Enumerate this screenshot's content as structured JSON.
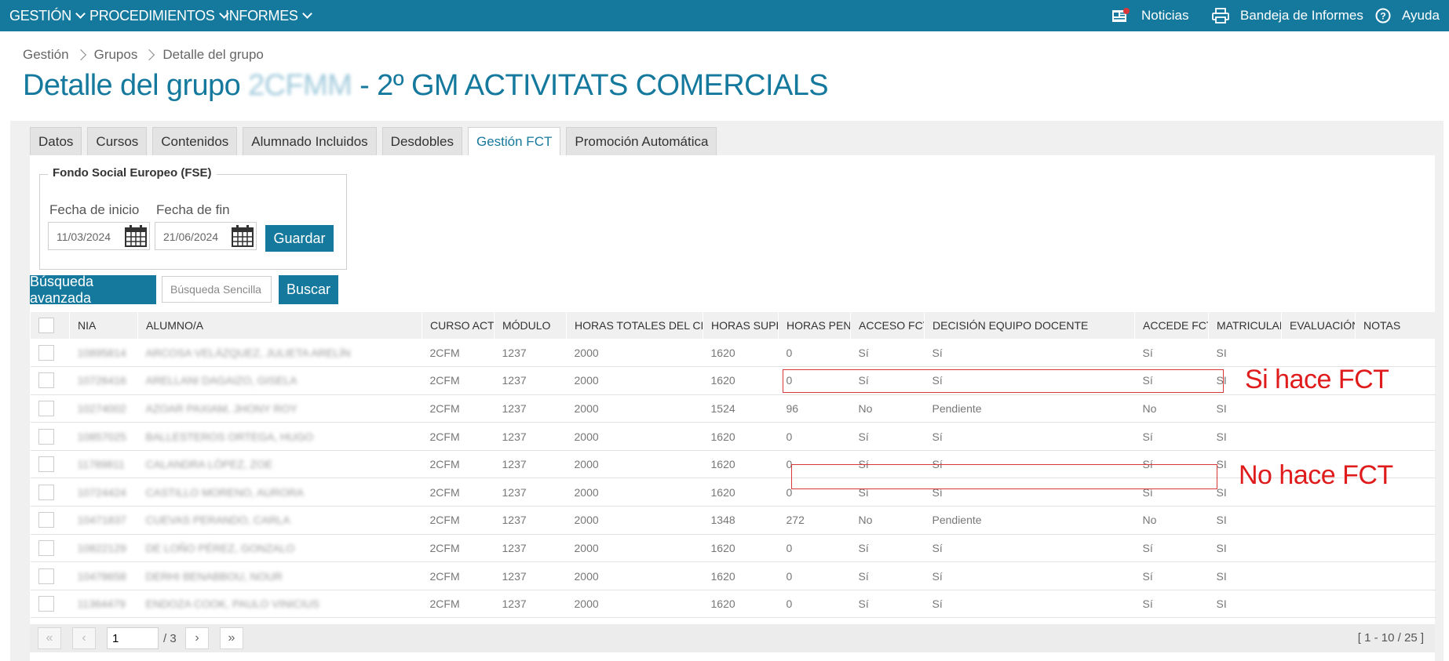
{
  "topbar": {
    "menu": [
      "GESTIÓN",
      "PROCEDIMIENTOS",
      "INFORMES"
    ],
    "noticias": "Noticias",
    "bandeja": "Bandeja de Informes",
    "ayuda": "Ayuda",
    "colors": {
      "bar": "#15799d"
    }
  },
  "breadcrumb": [
    "Gestión",
    "Grupos",
    "Detalle del grupo"
  ],
  "title": {
    "prefix": "Detalle del grupo",
    "code": "2CFMM",
    "suffix": "- 2º GM ACTIVITATS COMERCIALS"
  },
  "tabs": [
    "Datos",
    "Cursos",
    "Contenidos",
    "Alumnado Incluidos",
    "Desdobles",
    "Gestión FCT",
    "Promoción Automática"
  ],
  "active_tab": "Gestión FCT",
  "fse": {
    "legend": "Fondo Social Europeo (FSE)",
    "start_label": "Fecha de inicio",
    "start_value": "11/03/2024",
    "end_label": "Fecha de fin",
    "end_value": "21/06/2024",
    "save": "Guardar"
  },
  "search": {
    "advanced": "Búsqueda avanzada",
    "placeholder": "Búsqueda Sencilla",
    "button": "Buscar"
  },
  "table": {
    "headers": [
      "NIA",
      "ALUMNO/A",
      "CURSO ACTUAL",
      "MÓDULO",
      "HORAS TOTALES DEL CICLO",
      "HORAS SUPERADAS",
      "HORAS PENDIENTES",
      "ACCESO FCT",
      "DECISIÓN EQUIPO DOCENTE",
      "ACCEDE FCT",
      "MATRICULADO",
      "EVALUACIÓN",
      "NOTAS"
    ],
    "rows": [
      {
        "nia": "10895814",
        "alumno": "ARCOSA VELÁZQUEZ, JULIETA ARELÍN",
        "curso": "2CFM",
        "modulo": "1237",
        "totales": "2000",
        "superadas": "1620",
        "pendientes": "0",
        "acceso": "Sí",
        "decision": "Sí",
        "accede": "Sí",
        "matriculado": "SI",
        "evaluacion": "",
        "notas": ""
      },
      {
        "nia": "10726416",
        "alumno": "ARELLANI DAGAIZO, GISELA",
        "curso": "2CFM",
        "modulo": "1237",
        "totales": "2000",
        "superadas": "1620",
        "pendientes": "0",
        "acceso": "Sí",
        "decision": "Sí",
        "accede": "Sí",
        "matriculado": "SI",
        "evaluacion": "",
        "notas": ""
      },
      {
        "nia": "10274002",
        "alumno": "AZOAR PAXIAM, JHONY ROY",
        "curso": "2CFM",
        "modulo": "1237",
        "totales": "2000",
        "superadas": "1524",
        "pendientes": "96",
        "acceso": "No",
        "decision": "Pendiente",
        "accede": "No",
        "matriculado": "SI",
        "evaluacion": "",
        "notas": ""
      },
      {
        "nia": "10857025",
        "alumno": "BALLESTEROS ORTEGA, HUGO",
        "curso": "2CFM",
        "modulo": "1237",
        "totales": "2000",
        "superadas": "1620",
        "pendientes": "0",
        "acceso": "Sí",
        "decision": "Sí",
        "accede": "Sí",
        "matriculado": "SI",
        "evaluacion": "",
        "notas": ""
      },
      {
        "nia": "11789811",
        "alumno": "CALANDRA LÓPEZ, ZOE",
        "curso": "2CFM",
        "modulo": "1237",
        "totales": "2000",
        "superadas": "1620",
        "pendientes": "0",
        "acceso": "Sí",
        "decision": "Sí",
        "accede": "Sí",
        "matriculado": "SI",
        "evaluacion": "",
        "notas": ""
      },
      {
        "nia": "10724424",
        "alumno": "CASTILLO MORENO, AURORA",
        "curso": "2CFM",
        "modulo": "1237",
        "totales": "2000",
        "superadas": "1620",
        "pendientes": "0",
        "acceso": "Sí",
        "decision": "Sí",
        "accede": "Sí",
        "matriculado": "SI",
        "evaluacion": "",
        "notas": ""
      },
      {
        "nia": "10471837",
        "alumno": "CUEVAS PERANDO, CARLA",
        "curso": "2CFM",
        "modulo": "1237",
        "totales": "2000",
        "superadas": "1348",
        "pendientes": "272",
        "acceso": "No",
        "decision": "Pendiente",
        "accede": "No",
        "matriculado": "SI",
        "evaluacion": "",
        "notas": ""
      },
      {
        "nia": "10822129",
        "alumno": "DE LOÑO PÉREZ, GONZALO",
        "curso": "2CFM",
        "modulo": "1237",
        "totales": "2000",
        "superadas": "1620",
        "pendientes": "0",
        "acceso": "Sí",
        "decision": "Sí",
        "accede": "Sí",
        "matriculado": "SI",
        "evaluacion": "",
        "notas": ""
      },
      {
        "nia": "10478658",
        "alumno": "DERHI BENABBOU, NOUR",
        "curso": "2CFM",
        "modulo": "1237",
        "totales": "2000",
        "superadas": "1620",
        "pendientes": "0",
        "acceso": "Sí",
        "decision": "Sí",
        "accede": "Sí",
        "matriculado": "SI",
        "evaluacion": "",
        "notas": ""
      },
      {
        "nia": "11364479",
        "alumno": "ENDOZA COOK, PAULO VINICIUS",
        "curso": "2CFM",
        "modulo": "1237",
        "totales": "2000",
        "superadas": "1620",
        "pendientes": "0",
        "acceso": "Sí",
        "decision": "Sí",
        "accede": "Sí",
        "matriculado": "SI",
        "evaluacion": "",
        "notas": ""
      }
    ]
  },
  "annotations": {
    "row3": "Si hace FCT",
    "row7": "No hace FCT",
    "color": "#e01b1b"
  },
  "pager": {
    "page": "1",
    "total": "/ 3",
    "range": "[ 1 - 10 / 25 ]"
  }
}
